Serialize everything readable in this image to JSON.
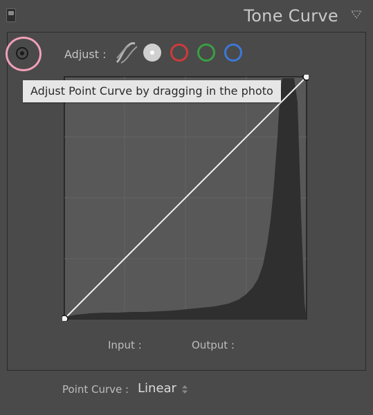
{
  "panel": {
    "title": "Tone Curve",
    "collapse_icon": "collapse-triangle-icon",
    "toggle_icon": "panel-switch-icon"
  },
  "toolbar": {
    "target_tool_icon": "target-adjust-icon",
    "adjust_label": "Adjust :",
    "channels": [
      {
        "name": "parametric",
        "icon": "parametric-curve-icon"
      },
      {
        "name": "rgb",
        "color": "#d0d0d0",
        "selected": true
      },
      {
        "name": "red",
        "color": "#d03a3a"
      },
      {
        "name": "green",
        "color": "#3aa043"
      },
      {
        "name": "blue",
        "color": "#3c78d8"
      }
    ]
  },
  "tooltip": {
    "text": "Adjust Point Curve by dragging in the photo"
  },
  "curve": {
    "points": [
      [
        0,
        0
      ],
      [
        255,
        255
      ]
    ],
    "histogram_color": "#2f2f2f"
  },
  "readout": {
    "input_label": "Input :",
    "output_label": "Output :"
  },
  "point_curve": {
    "label": "Point Curve :",
    "value": "Linear"
  },
  "colors": {
    "panel_bg": "#4a4a4a",
    "curve_bg": "#585858",
    "accent_ring": "#f0a0b8"
  }
}
